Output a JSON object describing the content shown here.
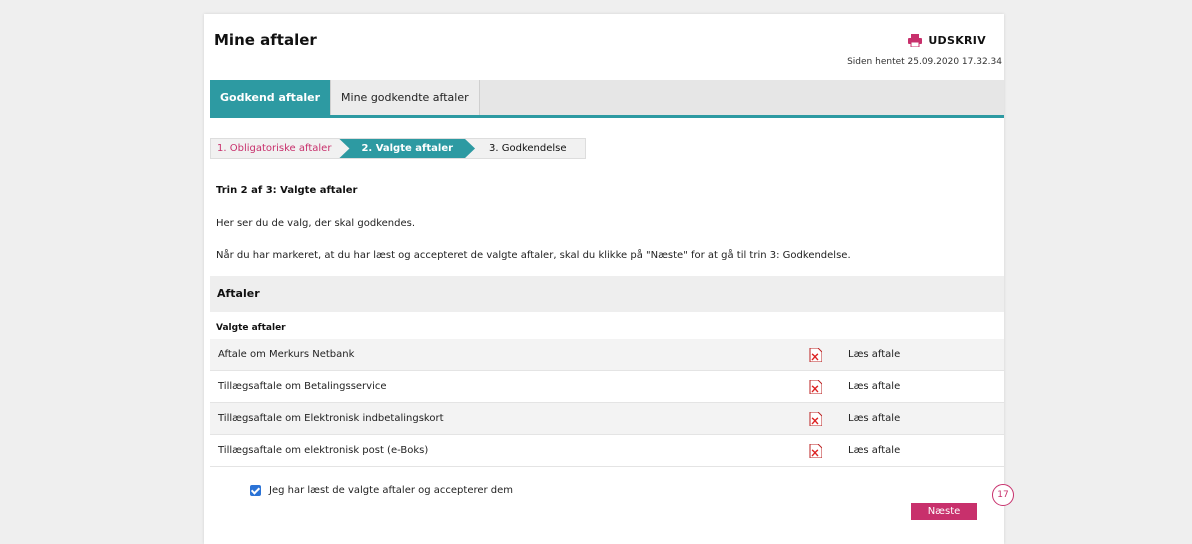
{
  "header": {
    "title": "Mine aftaler",
    "print_label": "UDSKRIV",
    "fetched": "Siden hentet 25.09.2020 17.32.34"
  },
  "tabs": [
    {
      "label": "Godkend aftaler",
      "active": true
    },
    {
      "label": "Mine godkendte aftaler",
      "active": false
    }
  ],
  "steps": [
    {
      "label": "1. Obligatoriske aftaler"
    },
    {
      "label": "2. Valgte aftaler"
    },
    {
      "label": "3. Godkendelse"
    }
  ],
  "content": {
    "step_title": "Trin 2 af 3: Valgte aftaler",
    "intro": "Her ser du de valg, der skal godkendes.",
    "instruction": "Når du har markeret, at du har læst og accepteret de valgte aftaler, skal du klikke på \"Næste\" for at gå til trin 3: Godkendelse.",
    "section_title": "Aftaler",
    "subsection_title": "Valgte aftaler",
    "agreements": [
      {
        "name": "Aftale om Merkurs Netbank",
        "link": "Læs aftale"
      },
      {
        "name": "Tillægsaftale om Betalingsservice",
        "link": "Læs aftale"
      },
      {
        "name": "Tillægsaftale om Elektronisk indbetalingskort",
        "link": "Læs aftale"
      },
      {
        "name": "Tillægsaftale om elektronisk post (e-Boks)",
        "link": "Læs aftale"
      }
    ],
    "accept_label": "Jeg har læst de valgte aftaler og accepterer dem",
    "accept_checked": true,
    "next_label": "Næste",
    "badge": "17"
  },
  "colors": {
    "accent": "#2d9aa2",
    "brand": "#c8306c",
    "checkbox": "#2b73d6"
  }
}
